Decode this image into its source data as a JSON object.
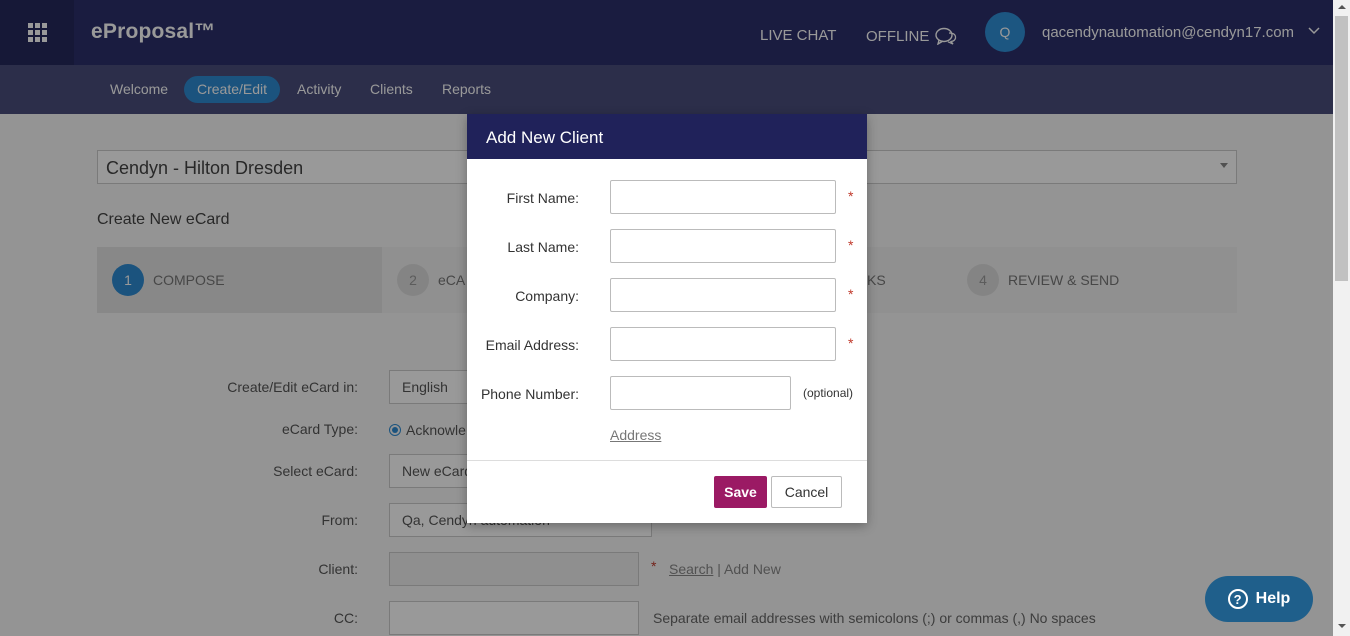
{
  "header": {
    "apps_icon": "apps-grid-icon",
    "logo": "eProposal™",
    "live_chat": "LIVE CHAT",
    "offline": "OFFLINE",
    "offline_icon": "chat-bubbles-icon",
    "avatar_initial": "Q",
    "user_email": "qacendynautomation@cendyn17.com"
  },
  "nav": {
    "items": [
      {
        "label": "Welcome"
      },
      {
        "label": "Create/Edit"
      },
      {
        "label": "Activity"
      },
      {
        "label": "Clients"
      },
      {
        "label": "Reports"
      }
    ],
    "active_index": 1
  },
  "page": {
    "property": "Cendyn - Hilton Dresden",
    "title": "Create New eCard",
    "steps": [
      {
        "num": "1",
        "label": "COMPOSE"
      },
      {
        "num": "2",
        "label": "eCA"
      },
      {
        "num": "",
        "label": "KS"
      },
      {
        "num": "4",
        "label": "REVIEW & SEND"
      }
    ],
    "form": {
      "language_label": "Create/Edit eCard in:",
      "language_value": "English",
      "type_label": "eCard Type:",
      "type_value": "Acknowle",
      "select_label": "Select eCard:",
      "select_value": "New eCard",
      "from_label": "From:",
      "from_value": "Qa, Cendyn automation",
      "client_label": "Client:",
      "client_star": "*",
      "client_search": "Search",
      "client_separator": "|",
      "client_add_new": "Add New",
      "cc_label": "CC:",
      "cc_hint": "Separate email addresses with semicolons (;) or commas (,) No spaces"
    }
  },
  "modal": {
    "title": "Add New Client",
    "fields": {
      "first_name": "First Name:",
      "last_name": "Last Name:",
      "company": "Company:",
      "email": "Email Address:",
      "phone": "Phone Number:"
    },
    "required_star": "*",
    "optional": "(optional)",
    "address_link": "Address",
    "save": "Save",
    "cancel": "Cancel"
  },
  "help": {
    "label": "Help",
    "icon": "?"
  },
  "colors": {
    "header_bg": "#2c2f6b",
    "nav_active": "#2e8bd3",
    "modal_header": "#20225a",
    "save_button": "#9b1a64",
    "help_button": "#1f5f8b"
  }
}
